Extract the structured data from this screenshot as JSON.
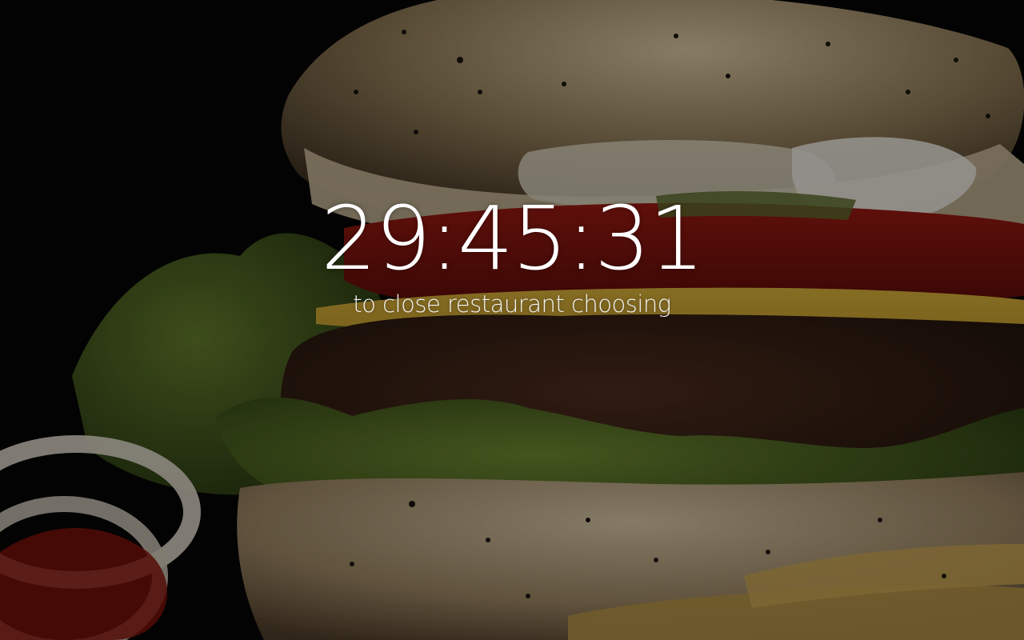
{
  "timer": {
    "value": "29:45:31",
    "caption": "to close restaurant choosing"
  },
  "background": {
    "subject": "hamburger photo",
    "icon": "hamburger-image"
  },
  "colors": {
    "text": "#ffffff",
    "overlay": "#000000"
  }
}
